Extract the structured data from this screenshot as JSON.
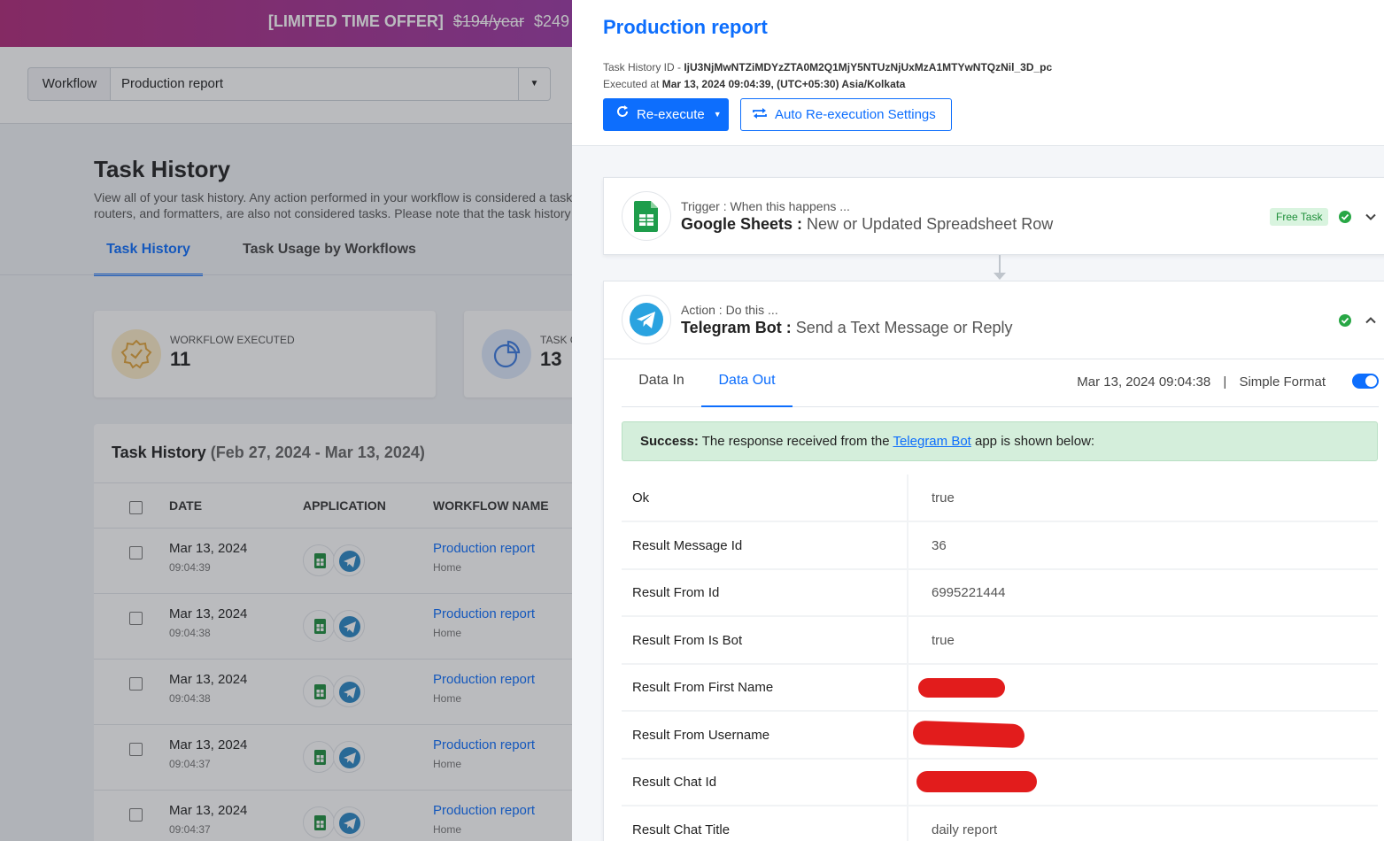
{
  "promo": {
    "text": "[LIMITED TIME OFFER]",
    "old_price": "$194/year",
    "new_price": "$249"
  },
  "workflow_bar": {
    "label": "Workflow",
    "selected": "Production report"
  },
  "task_history": {
    "title": "Task History",
    "description_1": "View all of your task history. Any action performed in your workflow is considered a task.",
    "description_2": "routers, and formatters, are also not considered tasks. Please note that the task history",
    "tabs": [
      "Task History",
      "Task Usage by Workflows"
    ],
    "stats": [
      {
        "label": "WORKFLOW EXECUTED",
        "value": "11"
      },
      {
        "label": "TASK CONSUMED",
        "value": "13"
      }
    ],
    "table_title": "Task History",
    "table_range": "(Feb 27, 2024 - Mar 13, 2024)",
    "columns": [
      "DATE",
      "APPLICATION",
      "WORKFLOW NAME"
    ],
    "rows": [
      {
        "date": "Mar 13, 2024",
        "time": "09:04:39",
        "workflow": "Production report",
        "folder": "Home"
      },
      {
        "date": "Mar 13, 2024",
        "time": "09:04:38",
        "workflow": "Production report",
        "folder": "Home"
      },
      {
        "date": "Mar 13, 2024",
        "time": "09:04:38",
        "workflow": "Production report",
        "folder": "Home"
      },
      {
        "date": "Mar 13, 2024",
        "time": "09:04:37",
        "workflow": "Production report",
        "folder": "Home"
      },
      {
        "date": "Mar 13, 2024",
        "time": "09:04:37",
        "workflow": "Production report",
        "folder": "Home"
      }
    ]
  },
  "panel": {
    "title": "Production report",
    "task_id_label": "Task History ID - ",
    "task_id": "IjU3NjMwNTZiMDYzZTA0M2Q1MjY5NTUzNjUxMzA1MTYwNTQzNil_3D_pc",
    "executed_label": "Executed at ",
    "executed_value": "Mar 13, 2024 09:04:39, (UTC+05:30) Asia/Kolkata",
    "reexecute_label": "Re-execute",
    "auto_label": "Auto Re-execution Settings",
    "trigger": {
      "kind": "Trigger : When this happens ...",
      "app": "Google Sheets :",
      "event": "New or Updated Spreadsheet Row",
      "badge": "Free Task"
    },
    "action": {
      "kind": "Action : Do this ...",
      "app": "Telegram Bot :",
      "event": "Send a Text Message or Reply"
    },
    "tabs": [
      "Data In",
      "Data Out"
    ],
    "timestamp": "Mar 13, 2024 09:04:38",
    "separator": "|",
    "format_label": "Simple Format",
    "success_bold": "Success:",
    "success_pre": " The response received from the ",
    "success_link": "Telegram Bot",
    "success_post": " app is shown below:",
    "fields": [
      {
        "key": "Ok",
        "value": "true"
      },
      {
        "key": "Result Message Id",
        "value": "36"
      },
      {
        "key": "Result From Id",
        "value": "6995221444"
      },
      {
        "key": "Result From Is Bot",
        "value": "true"
      },
      {
        "key": "Result From First Name",
        "value": ""
      },
      {
        "key": "Result From Username",
        "value": ""
      },
      {
        "key": "Result Chat Id",
        "value": ""
      },
      {
        "key": "Result Chat Title",
        "value": "daily report"
      }
    ]
  },
  "colors": {
    "accent": "#0d6efd",
    "success": "#28a745",
    "sheets_green": "#1e8e3e",
    "telegram_blue": "#2aa3e0",
    "redaction": "#e21c1c"
  },
  "icons": [
    "caret-down-icon",
    "badge-check-icon",
    "pie-chart-icon",
    "google-sheets-icon",
    "telegram-icon",
    "refresh-icon",
    "repeat-icon",
    "check-circle-icon",
    "chevron-down-icon",
    "chevron-up-icon"
  ]
}
